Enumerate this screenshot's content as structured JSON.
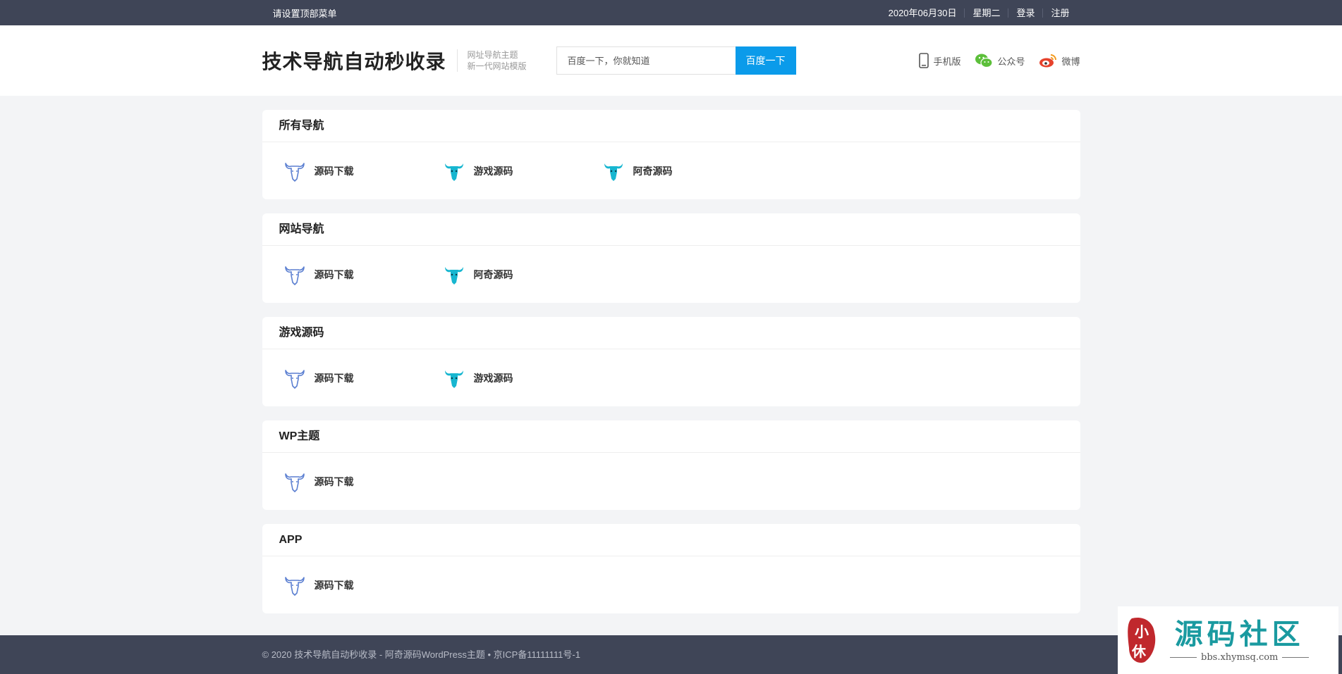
{
  "topbar": {
    "menu_hint": "请设置顶部菜单",
    "date": "2020年06月30日",
    "weekday": "星期二",
    "login": "登录",
    "register": "注册"
  },
  "header": {
    "logo": "技术导航自动秒收录",
    "slogan_line1": "网址导航主题",
    "slogan_line2": "新一代网站模版",
    "search_placeholder": "百度一下，你就知道",
    "search_button": "百度一下",
    "links": {
      "mobile": "手机版",
      "wechat": "公众号",
      "weibo": "微博"
    }
  },
  "categories": [
    {
      "title": "所有导航",
      "items": [
        {
          "label": "源码下载",
          "icon": "bull-outline-icon"
        },
        {
          "label": "游戏源码",
          "icon": "bull-filled-icon"
        },
        {
          "label": "阿奇源码",
          "icon": "bull-filled-icon"
        }
      ]
    },
    {
      "title": "网站导航",
      "items": [
        {
          "label": "源码下载",
          "icon": "bull-outline-icon"
        },
        {
          "label": "阿奇源码",
          "icon": "bull-filled-icon"
        }
      ]
    },
    {
      "title": "游戏源码",
      "items": [
        {
          "label": "源码下载",
          "icon": "bull-outline-icon"
        },
        {
          "label": "游戏源码",
          "icon": "bull-filled-icon"
        }
      ]
    },
    {
      "title": "WP主题",
      "items": [
        {
          "label": "源码下载",
          "icon": "bull-outline-icon"
        }
      ]
    },
    {
      "title": "APP",
      "items": [
        {
          "label": "源码下载",
          "icon": "bull-outline-icon"
        }
      ]
    }
  ],
  "footer": {
    "text": "© 2020 技术导航自动秒收录 - 阿奇源码WordPress主题 • 京ICP备11111111号-1"
  },
  "watermark": {
    "seal_text": "小",
    "seal_text2": "休",
    "title": "源码社区",
    "url": "bbs.xhymsq.com"
  },
  "colors": {
    "topbar_bg": "#3f4557",
    "accent": "#0b9bea",
    "outline_icon": "#5b7fd1",
    "filled_icon": "#17b6d0",
    "watermark_teal": "#1a9aa0",
    "seal_red": "#c0282d"
  }
}
